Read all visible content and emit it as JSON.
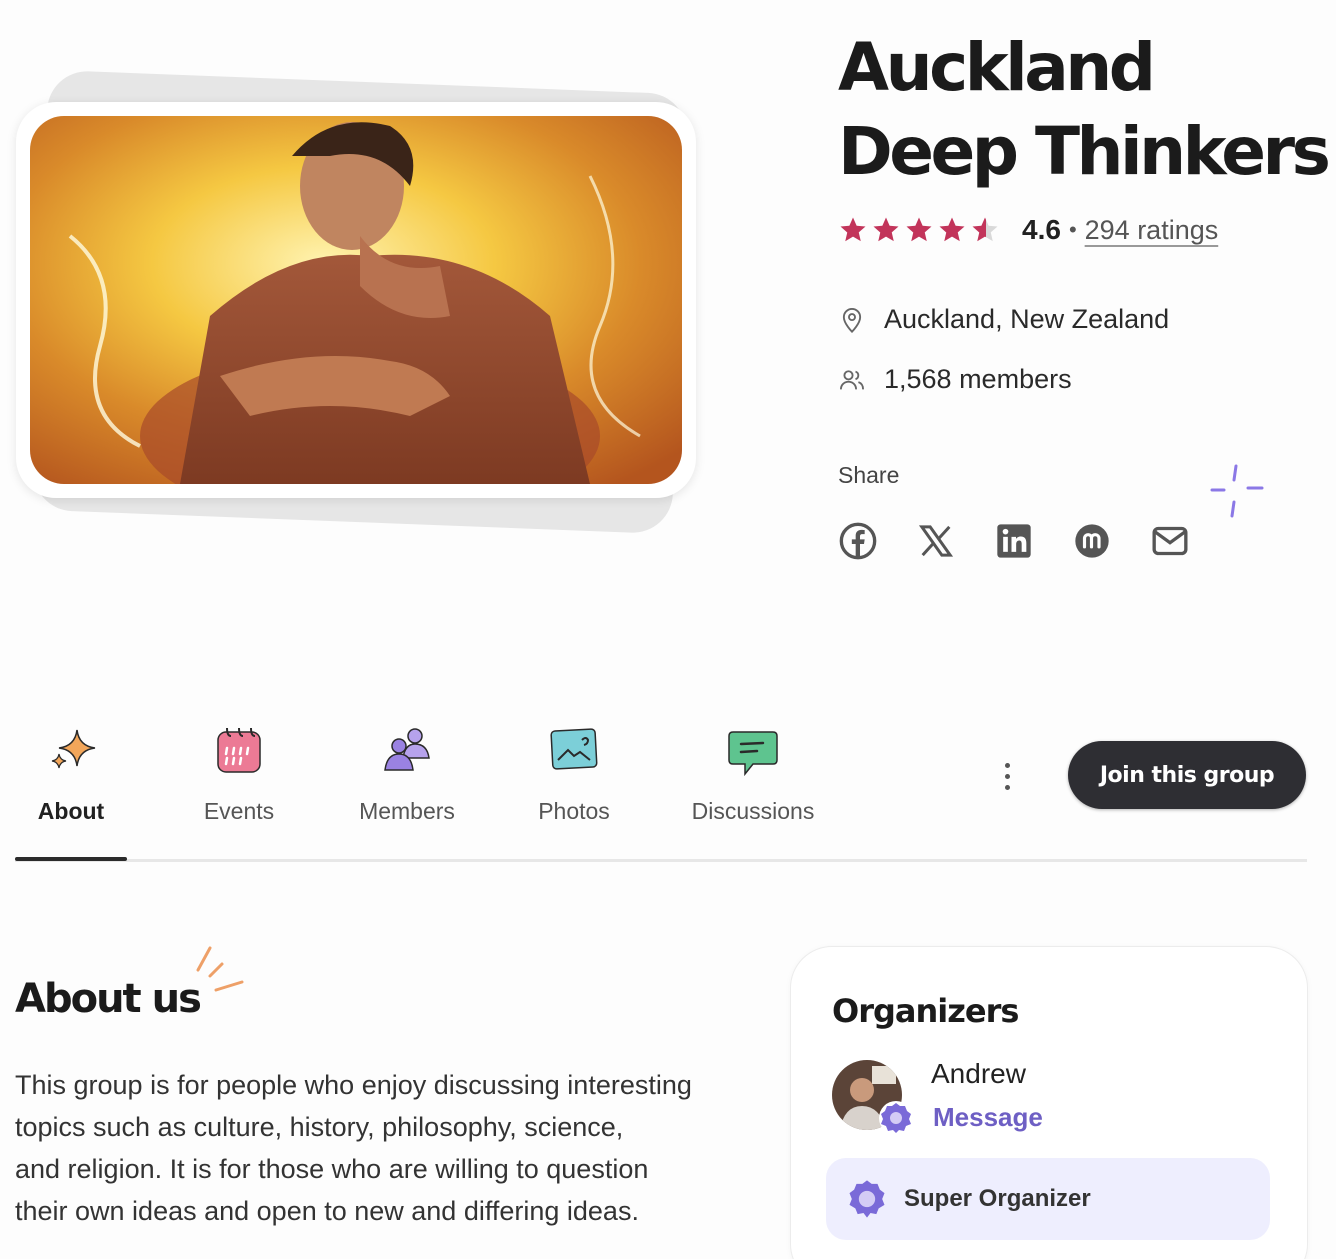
{
  "group": {
    "title_line1": "Auckland",
    "title_line2": "Deep Thinkers",
    "rating": "4.6",
    "rating_separator": "•",
    "ratings_count": "294 ratings",
    "stars_filled": 4.6,
    "location": "Auckland, New Zealand",
    "members": "1,568 members"
  },
  "share": {
    "label": "Share",
    "icons": [
      "facebook-icon",
      "x-icon",
      "linkedin-icon",
      "meetup-icon",
      "email-icon"
    ]
  },
  "tabs": [
    {
      "label": "About",
      "icon": "sparkle-icon",
      "active": true
    },
    {
      "label": "Events",
      "icon": "calendar-icon",
      "active": false
    },
    {
      "label": "Members",
      "icon": "people-icon",
      "active": false
    },
    {
      "label": "Photos",
      "icon": "photo-icon",
      "active": false
    },
    {
      "label": "Discussions",
      "icon": "chat-icon",
      "active": false
    }
  ],
  "actions": {
    "join_label": "Join this group",
    "more_icon": "more-vertical-icon"
  },
  "about": {
    "heading": "About us",
    "line1": "This group is for people who enjoy discussing interesting",
    "line2": "topics such as culture, history, philosophy, science,",
    "line3": "and religion. It is for those who are willing to question",
    "line4": "their own ideas and open to new and differing ideas."
  },
  "organizers": {
    "heading": "Organizers",
    "name": "Andrew",
    "message_label": "Message",
    "badge_label": "Super Organizer"
  },
  "colors": {
    "star": "#c2345a",
    "accent_purple": "#6e5fc4",
    "join_button": "#2e2e33",
    "badge_bg": "#eeeefe"
  }
}
